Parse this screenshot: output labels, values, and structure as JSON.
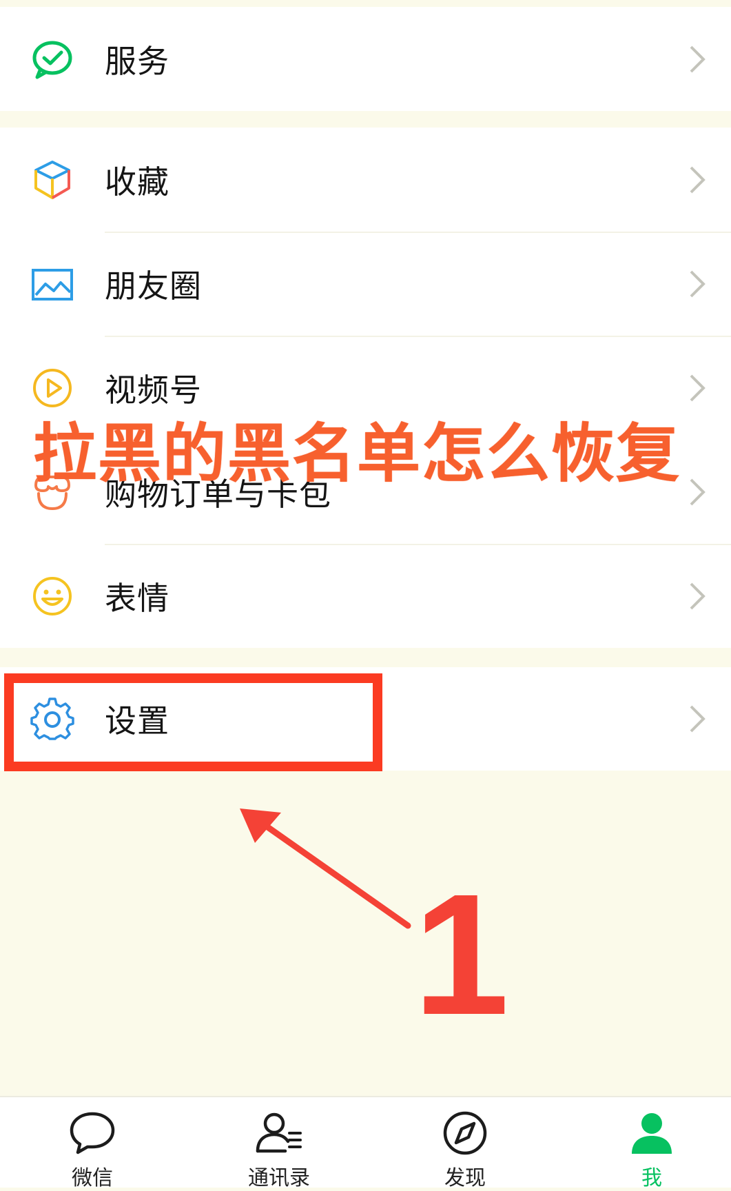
{
  "colors": {
    "accent_green": "#07c160",
    "highlight_red": "#fb3b22",
    "overlay_orange": "#f7602e"
  },
  "menu": {
    "service": {
      "label": "服务",
      "icon": "wechat-pay-icon"
    },
    "favorites": {
      "label": "收藏",
      "icon": "cube-icon"
    },
    "moments": {
      "label": "朋友圈",
      "icon": "picture-icon"
    },
    "channels": {
      "label": "视频号",
      "icon": "play-icon"
    },
    "orders": {
      "label": "购物订单与卡包",
      "icon": "shop-icon"
    },
    "stickers": {
      "label": "表情",
      "icon": "smiley-icon"
    },
    "settings": {
      "label": "设置",
      "icon": "gear-icon"
    }
  },
  "overlay": {
    "title": "拉黑的黑名单怎么恢复",
    "step_number": "1"
  },
  "tabbar": {
    "tabs": [
      {
        "label": "微信",
        "icon": "chat-bubble-icon",
        "active": false
      },
      {
        "label": "通讯录",
        "icon": "contacts-icon",
        "active": false
      },
      {
        "label": "发现",
        "icon": "compass-icon",
        "active": false
      },
      {
        "label": "我",
        "icon": "person-icon",
        "active": true
      }
    ]
  }
}
